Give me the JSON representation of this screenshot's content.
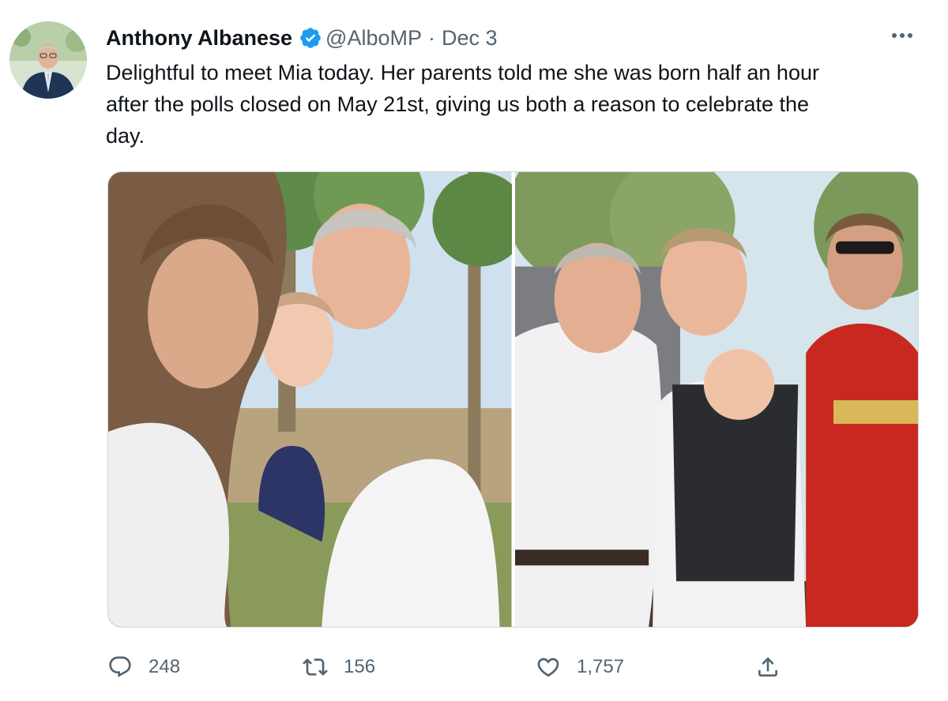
{
  "tweet": {
    "author_name": "Anthony Albanese",
    "handle": "@AlboMP",
    "separator": "·",
    "date": "Dec 3",
    "text": "Delightful to meet Mia today. Her parents told me she was born half an hour\nafter the polls closed on May 21st, giving us both a reason to celebrate the\nday.",
    "verified": true,
    "accent_color": "#1d9bf0"
  },
  "media": {
    "count": 2,
    "photos": [
      {
        "description_icon": "photo-icon"
      },
      {
        "description_icon": "photo-icon"
      }
    ]
  },
  "actions": {
    "reply_count": "248",
    "retweet_count": "156",
    "like_count": "1,757"
  }
}
